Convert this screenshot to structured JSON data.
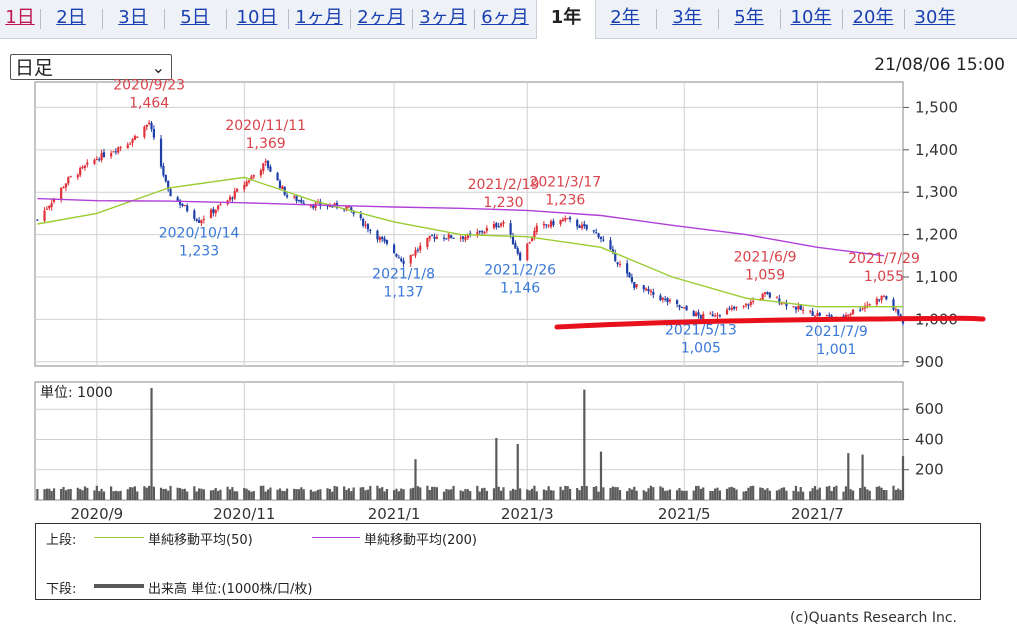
{
  "tabs": [
    {
      "label": "1日",
      "state": "day"
    },
    {
      "label": "2日"
    },
    {
      "label": "3日"
    },
    {
      "label": "5日"
    },
    {
      "label": "10日"
    },
    {
      "label": "1ヶ月"
    },
    {
      "label": "2ヶ月"
    },
    {
      "label": "3ヶ月"
    },
    {
      "label": "6ヶ月"
    },
    {
      "label": "1年",
      "state": "active"
    },
    {
      "label": "2年"
    },
    {
      "label": "3年"
    },
    {
      "label": "5年"
    },
    {
      "label": "10年"
    },
    {
      "label": "20年"
    },
    {
      "label": "30年"
    }
  ],
  "period_select": {
    "value": "日足"
  },
  "timestamp": "21/08/06 15:00",
  "credit": "(c)Quants Research Inc.",
  "colors": {
    "candle_up": "#e0303a",
    "candle_down": "#1e3fa8",
    "ma50": "#9acd32",
    "ma200": "#b040d8",
    "high_label": "#d9434a",
    "low_label": "#3a78d8",
    "volume": "#5a5a5a",
    "annotation_stroke": "#e8101a"
  },
  "chart_data": [
    {
      "type": "line",
      "title": "",
      "y_ticks": [
        900,
        1000,
        1100,
        1200,
        1300,
        1400,
        1500
      ],
      "y_tick_labels": [
        "900",
        "1,000",
        "1,100",
        "1,200",
        "1,300",
        "1,400",
        "1,500"
      ],
      "ylim": [
        890,
        1560
      ],
      "x_tick_labels": [
        "2020/9",
        "2020/11",
        "2021/1",
        "2021/3",
        "2021/5",
        "2021/7"
      ],
      "x_tick_dates": [
        "2020-09-01",
        "2020-11-02",
        "2021-01-04",
        "2021-03-01",
        "2021-05-06",
        "2021-07-01"
      ],
      "xlim": [
        "2020-08-06",
        "2021-08-06"
      ],
      "grid": true,
      "price_series": {
        "name": "",
        "dates": [
          "2020-08-07",
          "2020-08-20",
          "2020-09-01",
          "2020-09-15",
          "2020-09-23",
          "2020-10-01",
          "2020-10-14",
          "2020-10-26",
          "2020-11-11",
          "2020-11-20",
          "2020-12-01",
          "2020-12-15",
          "2021-01-08",
          "2021-01-20",
          "2021-02-05",
          "2021-02-19",
          "2021-02-26",
          "2021-03-05",
          "2021-03-17",
          "2021-03-31",
          "2021-04-15",
          "2021-05-13",
          "2021-05-31",
          "2021-06-09",
          "2021-06-25",
          "2021-07-09",
          "2021-07-20",
          "2021-07-29",
          "2021-08-06"
        ],
        "values": [
          1235,
          1330,
          1380,
          1420,
          1464,
          1300,
          1233,
          1280,
          1369,
          1290,
          1270,
          1265,
          1137,
          1195,
          1195,
          1230,
          1146,
          1215,
          1236,
          1200,
          1080,
          1005,
          1030,
          1059,
          1020,
          1001,
          1030,
          1055,
          995
        ]
      },
      "series": [
        {
          "name": "単純移動平均(50)",
          "dates": [
            "2020-08-07",
            "2020-09-01",
            "2020-10-01",
            "2020-11-02",
            "2020-12-01",
            "2021-01-04",
            "2021-02-01",
            "2021-03-01",
            "2021-04-01",
            "2021-05-01",
            "2021-06-01",
            "2021-07-01",
            "2021-08-06"
          ],
          "values": [
            1225,
            1250,
            1310,
            1335,
            1280,
            1230,
            1200,
            1195,
            1170,
            1100,
            1050,
            1030,
            1030
          ]
        },
        {
          "name": "単純移動平均(200)",
          "dates": [
            "2020-08-07",
            "2020-09-01",
            "2020-10-01",
            "2020-11-02",
            "2020-12-01",
            "2021-01-04",
            "2021-02-01",
            "2021-03-01",
            "2021-04-01",
            "2021-05-01",
            "2021-06-01",
            "2021-07-01",
            "2021-07-29"
          ],
          "values": [
            1285,
            1280,
            1279,
            1275,
            1270,
            1265,
            1262,
            1257,
            1245,
            1222,
            1200,
            1170,
            1150
          ]
        }
      ],
      "annotations": [
        {
          "kind": "high",
          "date_label": "2020/9/23",
          "value_label": "1,464",
          "date": "2020-09-23",
          "value": 1464
        },
        {
          "kind": "low",
          "date_label": "2020/10/14",
          "value_label": "1,233",
          "date": "2020-10-14",
          "value": 1233
        },
        {
          "kind": "high",
          "date_label": "2020/11/11",
          "value_label": "1,369",
          "date": "2020-11-11",
          "value": 1369
        },
        {
          "kind": "low",
          "date_label": "2021/1/8",
          "value_label": "1,137",
          "date": "2021-01-08",
          "value": 1137
        },
        {
          "kind": "high",
          "date_label": "2021/2/19",
          "value_label": "1,230",
          "date": "2021-02-19",
          "value": 1230
        },
        {
          "kind": "low",
          "date_label": "2021/2/26",
          "value_label": "1,146",
          "date": "2021-02-26",
          "value": 1146
        },
        {
          "kind": "high",
          "date_label": "2021/3/17",
          "value_label": "1,236",
          "date": "2021-03-17",
          "value": 1236
        },
        {
          "kind": "low",
          "date_label": "2021/5/13",
          "value_label": "1,005",
          "date": "2021-05-13",
          "value": 1005
        },
        {
          "kind": "high",
          "date_label": "2021/6/9",
          "value_label": "1,059",
          "date": "2021-06-09",
          "value": 1059
        },
        {
          "kind": "low",
          "date_label": "2021/7/9",
          "value_label": "1,001",
          "date": "2021-07-09",
          "value": 1001
        },
        {
          "kind": "high",
          "date_label": "2021/7/29",
          "value_label": "1,055",
          "date": "2021-07-29",
          "value": 1055
        }
      ]
    },
    {
      "type": "bar",
      "title": "単位: 1000",
      "y_ticks": [
        200,
        400,
        600
      ],
      "y_tick_labels": [
        "200",
        "400",
        "600"
      ],
      "ylim": [
        0,
        780
      ],
      "xlim": [
        "2020-08-06",
        "2021-08-06"
      ],
      "series": [
        {
          "name": "出来高",
          "baseline": 55,
          "spikes": [
            {
              "date": "2020-09-24",
              "value": 740
            },
            {
              "date": "2021-01-13",
              "value": 270
            },
            {
              "date": "2021-02-16",
              "value": 410
            },
            {
              "date": "2021-02-25",
              "value": 370
            },
            {
              "date": "2021-03-25",
              "value": 730
            },
            {
              "date": "2021-04-01",
              "value": 320
            },
            {
              "date": "2021-07-14",
              "value": 310
            },
            {
              "date": "2021-07-20",
              "value": 300
            },
            {
              "date": "2021-08-06",
              "value": 290
            }
          ]
        }
      ]
    }
  ],
  "legend": {
    "upper_label": "上段:",
    "lower_label": "下段:",
    "items": [
      {
        "label": "単純移動平均(50)"
      },
      {
        "label": "単純移動平均(200)"
      },
      {
        "label": "出来高 単位:(1000株/口/枚)"
      }
    ]
  }
}
